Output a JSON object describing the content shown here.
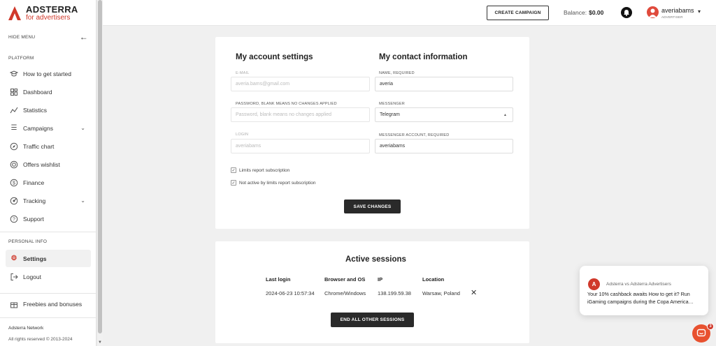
{
  "brand": {
    "name": "ADSTERRA",
    "tagline": "for advertisers",
    "accent_color": "#d0392b"
  },
  "sidebar": {
    "hide_menu_label": "HIDE MENU",
    "platform_label": "PLATFORM",
    "items": [
      {
        "label": "How to get started",
        "icon": "graduation-cap-icon"
      },
      {
        "label": "Dashboard",
        "icon": "dashboard-grid-icon"
      },
      {
        "label": "Statistics",
        "icon": "line-chart-icon"
      },
      {
        "label": "Campaigns",
        "icon": "list-icon"
      },
      {
        "label": "Traffic chart",
        "icon": "compass-icon"
      },
      {
        "label": "Offers wishlist",
        "icon": "target-icon"
      },
      {
        "label": "Finance",
        "icon": "dollar-icon"
      },
      {
        "label": "Tracking",
        "icon": "tracking-icon"
      },
      {
        "label": "Support",
        "icon": "help-icon"
      }
    ],
    "personal_label": "PERSONAL INFO",
    "personal_items": [
      {
        "label": "Settings",
        "icon": "gear-icon",
        "active": true
      },
      {
        "label": "Logout",
        "icon": "logout-icon"
      }
    ],
    "freebies_label": "Freebies and bonuses",
    "footer_name": "Adsterra Network",
    "footer_copy": "All rights reserved © 2013-2024"
  },
  "header": {
    "create_campaign": "CREATE CAMPAIGN",
    "balance_label": "Balance:",
    "balance_value": "$0.00",
    "user_name": "averiabams",
    "user_role": "ADVERTISER"
  },
  "account": {
    "title": "My account settings",
    "email_label": "E-MAIL",
    "email_value": "averia.bams@gmail.com",
    "password_label": "PASSWORD, BLANK MEANS NO CHANGES APPLIED",
    "password_placeholder": "Password, blank means no changes applied",
    "login_label": "LOGIN",
    "login_value": "averiabams"
  },
  "contact": {
    "title": "My contact information",
    "name_label": "NAME, REQUIRED",
    "name_value": "averia",
    "messenger_label": "MESSENGER",
    "messenger_value": "Telegram",
    "messenger_account_label": "MESSENGER ACCOUNT, REQUIRED",
    "messenger_account_value": "averiabams"
  },
  "checkboxes": {
    "limits": "Limits report subscription",
    "not_active": "Not active by limits report subscription"
  },
  "save_changes": "SAVE CHANGES",
  "sessions": {
    "title": "Active sessions",
    "headers": {
      "last_login": "Last login",
      "browser": "Browser and OS",
      "ip": "IP",
      "location": "Location"
    },
    "row": {
      "last_login": "2024-06-23 10:57:34",
      "browser": "Chrome/Windows",
      "ip": "138.199.59.38",
      "location": "Warsaw, Poland"
    },
    "end_all": "END ALL OTHER SESSIONS"
  },
  "chat": {
    "from": "Adsterra vs Adsterra Advertisers",
    "message": "Your 10% cashback awaits How to get it? Run iGaming campaigns during the Copa America…",
    "badge": "3"
  }
}
